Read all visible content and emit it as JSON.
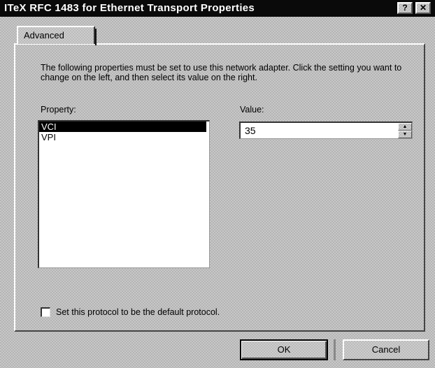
{
  "window": {
    "title": "ITeX RFC 1483 for Ethernet Transport Properties",
    "help_button": "?",
    "close_button": "✕"
  },
  "tabs": [
    {
      "label": "Advanced",
      "active": true
    }
  ],
  "description": "The following properties must be set to use this network adapter. Click the setting you want to change on the left, and then select its value on the right.",
  "property": {
    "label": "Property:",
    "items": [
      "VCI",
      "VPI"
    ],
    "selected": "VCI"
  },
  "value": {
    "label": "Value:",
    "current": "35"
  },
  "default_protocol": {
    "label": "Set this protocol to be the default protocol.",
    "checked": false
  },
  "buttons": {
    "ok": "OK",
    "cancel": "Cancel"
  }
}
